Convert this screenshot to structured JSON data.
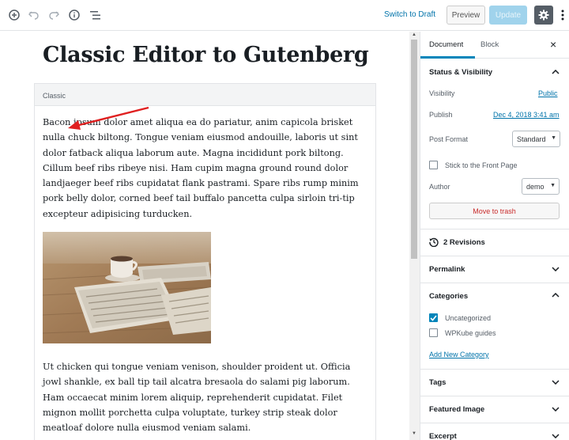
{
  "toolbar": {
    "switch_to_draft": "Switch to Draft",
    "preview": "Preview",
    "update": "Update"
  },
  "editor": {
    "title": "Classic Editor to Gutenberg",
    "classic_block_label": "Classic",
    "paragraph_1": "Bacon ipsum dolor amet aliqua ea do pariatur, anim capicola brisket nulla chuck biltong. Tongue veniam eiusmod andouille, laboris ut sint dolor fatback aliqua laborum aute. Magna incididunt pork biltong. Cillum beef ribs ribeye nisi. Ham cupim magna ground round dolor landjaeger beef ribs cupidatat flank pastrami. Spare ribs rump minim pork belly dolor, corned beef tail buffalo pancetta culpa sirloin tri-tip excepteur adipisicing turducken.",
    "paragraph_2": "Ut chicken qui tongue veniam venison, shoulder proident ut. Officia jowl shankle, ex ball tip tail alcatra bresaola do salami pig laborum. Ham occaecat minim lorem aliquip, reprehenderit cupidatat. Filet mignon mollit porchetta culpa voluptate, turkey strip steak dolor meatloaf dolore nulla eiusmod veniam salami."
  },
  "sidebar": {
    "tabs": {
      "document": "Document",
      "block": "Block"
    },
    "status": {
      "heading": "Status & Visibility",
      "visibility_label": "Visibility",
      "visibility_value": "Public",
      "publish_label": "Publish",
      "publish_value": "Dec 4, 2018 3:41 am",
      "post_format_label": "Post Format",
      "post_format_value": "Standard",
      "sticky_label": "Stick to the Front Page",
      "author_label": "Author",
      "author_value": "demo",
      "trash_label": "Move to trash"
    },
    "revisions": "2 Revisions",
    "permalink": "Permalink",
    "categories": {
      "heading": "Categories",
      "items": [
        {
          "label": "Uncategorized",
          "checked": true
        },
        {
          "label": "WPKube guides",
          "checked": false
        }
      ],
      "add_new": "Add New Category"
    },
    "tags": "Tags",
    "featured_image": "Featured Image",
    "excerpt": "Excerpt"
  },
  "colors": {
    "accent": "#0085ba",
    "link": "#0073aa",
    "annotation_arrow": "#e02020",
    "danger": "#c92c2c"
  }
}
